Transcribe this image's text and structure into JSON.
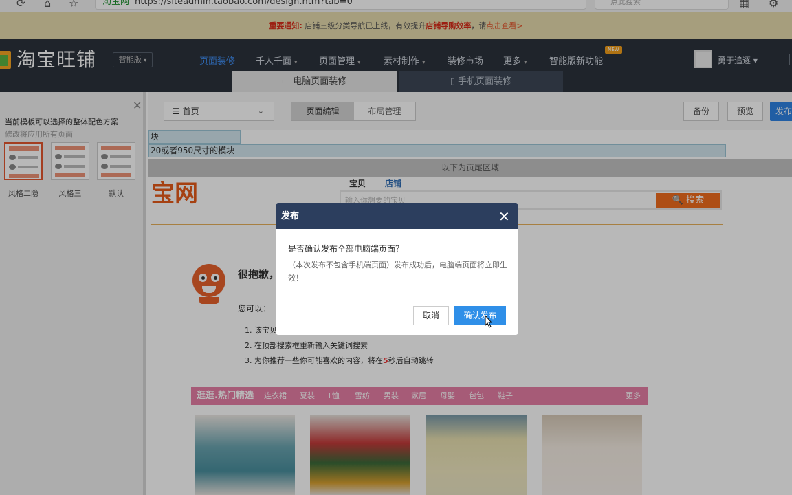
{
  "browser": {
    "url_prefix": "淘宝网",
    "url": "https://siteadmin.taobao.com/design.htm?tab=0",
    "search_placeholder": "点此搜索"
  },
  "notice": {
    "label": "重要通知:",
    "text": "店铺三级分类导航已上线，有效提升",
    "highlight": "店铺导购效率",
    "suffix": "，请",
    "link": "点击查看>"
  },
  "header": {
    "logo_text": "淘宝旺铺",
    "edition": "智能版",
    "nav": [
      {
        "label": "页面装修",
        "arrow": ""
      },
      {
        "label": "千人千面",
        "arrow": "▾"
      },
      {
        "label": "页面管理",
        "arrow": "▾"
      },
      {
        "label": "素材制作",
        "arrow": "▾"
      },
      {
        "label": "装修市场",
        "arrow": ""
      },
      {
        "label": "更多",
        "arrow": "▾"
      },
      {
        "label": "智能版新功能",
        "arrow": ""
      }
    ],
    "new_badge": "NEW",
    "user": "勇于追逐 ▾",
    "tabs": {
      "pc": "电脑页面装修",
      "mobile": "手机页面装修"
    }
  },
  "sidepanel": {
    "title": "当前模板可以选择的整体配色方案",
    "subtitle": "修改将应用所有页面",
    "themes": [
      {
        "label": "风格二隐"
      },
      {
        "label": "风格三"
      },
      {
        "label": "默认"
      }
    ]
  },
  "toolbar": {
    "page_select": "首页",
    "seg_edit": "页面编辑",
    "seg_layout": "布局管理",
    "backup": "备份",
    "preview": "预览",
    "publish": "发布"
  },
  "canvas": {
    "block1": "块",
    "block2": "20或者950尺寸的模块",
    "footer_area": "以下为页尾区域",
    "logo_text": "宝网",
    "search_tabs": [
      "宝贝",
      "店铺"
    ],
    "search_placeholder": "输入你想要的宝贝",
    "search_button": "搜索",
    "sorry": "很抱歉，",
    "you_can": "您可以：",
    "steps": [
      "1. 该宝贝",
      "2. 在顶部搜索框重新输入关键词搜索",
      "3. 为你推荐一些你可能喜欢的内容，将在",
      "5",
      "秒后自动跳转"
    ],
    "hot_title": "逛逛.热门精选",
    "hot_cats": [
      "连衣裙",
      "夏装",
      "T恤",
      "雪纺",
      "男装",
      "家居",
      "母婴",
      "包包",
      "鞋子"
    ],
    "hot_more": "更多"
  },
  "dialog": {
    "title": "发布",
    "question": "是否确认发布全部电脑端页面？",
    "note": "（本次发布不包含手机端页面）发布成功后，电脑端页面将立即生效！",
    "cancel": "取消",
    "confirm": "确认发布"
  },
  "colors": {
    "nav_bg": "#2c323c",
    "accent_blue": "#2f8fe8",
    "dialog_head": "#2c3e5e",
    "notice_bg": "#e7dcae",
    "orange": "#f26d1e"
  }
}
